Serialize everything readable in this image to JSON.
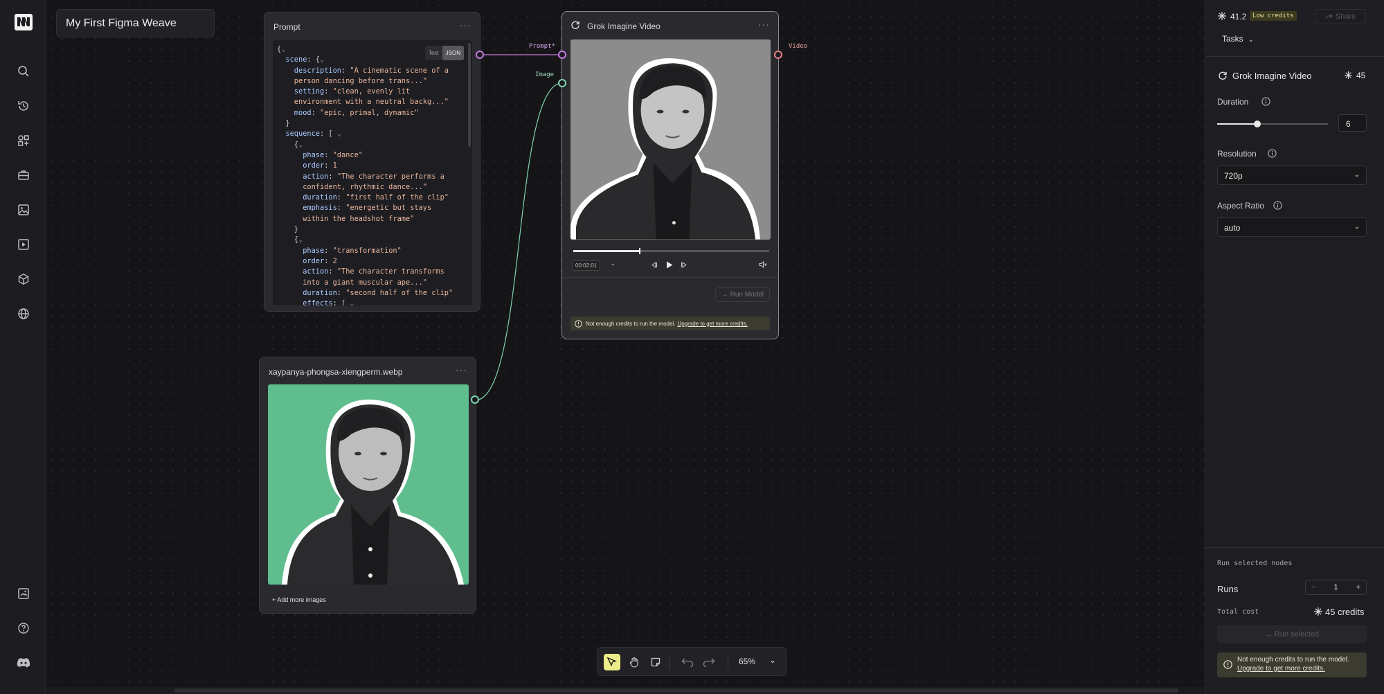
{
  "project": {
    "title": "My First Figma Weave"
  },
  "prompt_node": {
    "title": "Prompt",
    "menu": "···",
    "toggle": [
      "Text",
      "JSON"
    ],
    "lines": [
      [
        {
          "t": "{",
          "c": "p"
        },
        {
          "t": "⌄",
          "c": "c"
        }
      ],
      [
        {
          "t": "  scene",
          "c": "k"
        },
        {
          "t": ": {",
          "c": "p"
        },
        {
          "t": "⌄",
          "c": "c"
        }
      ],
      [
        {
          "t": "    description",
          "c": "k"
        },
        {
          "t": ": ",
          "c": "p"
        },
        {
          "t": "\"A cinematic scene of a",
          "c": "s"
        }
      ],
      [
        {
          "t": "    person dancing before trans...\"",
          "c": "s"
        }
      ],
      [
        {
          "t": "    setting",
          "c": "k"
        },
        {
          "t": ": ",
          "c": "p"
        },
        {
          "t": "\"clean, evenly lit",
          "c": "s"
        }
      ],
      [
        {
          "t": "    environment with a neutral backg...\"",
          "c": "s"
        }
      ],
      [
        {
          "t": "    mood",
          "c": "k"
        },
        {
          "t": ": ",
          "c": "p"
        },
        {
          "t": "\"epic, primal, dynamic\"",
          "c": "s"
        }
      ],
      [
        {
          "t": "  }",
          "c": "p"
        }
      ],
      [
        {
          "t": "  sequence",
          "c": "k"
        },
        {
          "t": ": [ ",
          "c": "p"
        },
        {
          "t": "⌄",
          "c": "c"
        }
      ],
      [
        {
          "t": "    {",
          "c": "p"
        },
        {
          "t": "⌄",
          "c": "c"
        }
      ],
      [
        {
          "t": "      phase",
          "c": "k"
        },
        {
          "t": ": ",
          "c": "p"
        },
        {
          "t": "\"dance\"",
          "c": "s"
        }
      ],
      [
        {
          "t": "      order",
          "c": "k"
        },
        {
          "t": ": ",
          "c": "p"
        },
        {
          "t": "1",
          "c": "n"
        }
      ],
      [
        {
          "t": "      action",
          "c": "k"
        },
        {
          "t": ": ",
          "c": "p"
        },
        {
          "t": "\"The character performs a",
          "c": "s"
        }
      ],
      [
        {
          "t": "      confident, rhythmic dance...\"",
          "c": "s"
        }
      ],
      [
        {
          "t": "      duration",
          "c": "k"
        },
        {
          "t": ": ",
          "c": "p"
        },
        {
          "t": "\"first half of the clip\"",
          "c": "s"
        }
      ],
      [
        {
          "t": "      emphasis",
          "c": "k"
        },
        {
          "t": ": ",
          "c": "p"
        },
        {
          "t": "\"energetic but stays",
          "c": "s"
        }
      ],
      [
        {
          "t": "      within the headshot frame\"",
          "c": "s"
        }
      ],
      [
        {
          "t": "    }",
          "c": "p"
        }
      ],
      [
        {
          "t": "    {",
          "c": "p"
        },
        {
          "t": "⌄",
          "c": "c"
        }
      ],
      [
        {
          "t": "      phase",
          "c": "k"
        },
        {
          "t": ": ",
          "c": "p"
        },
        {
          "t": "\"transformation\"",
          "c": "s"
        }
      ],
      [
        {
          "t": "      order",
          "c": "k"
        },
        {
          "t": ": ",
          "c": "p"
        },
        {
          "t": "2",
          "c": "n"
        }
      ],
      [
        {
          "t": "      action",
          "c": "k"
        },
        {
          "t": ": ",
          "c": "p"
        },
        {
          "t": "\"The character transforms",
          "c": "s"
        }
      ],
      [
        {
          "t": "      into a giant muscular ape...\"",
          "c": "s"
        }
      ],
      [
        {
          "t": "      duration",
          "c": "k"
        },
        {
          "t": ": ",
          "c": "p"
        },
        {
          "t": "\"second half of the clip\"",
          "c": "s"
        }
      ],
      [
        {
          "t": "      effects",
          "c": "k"
        },
        {
          "t": ": [ ",
          "c": "p"
        },
        {
          "t": "⌄",
          "c": "c"
        }
      ]
    ]
  },
  "image_node": {
    "title": "xaypanya-phongsa-xiengperm.webp",
    "menu": "···",
    "add_more": "+ Add more images"
  },
  "video_node": {
    "title": "Grok Imagine Video",
    "menu": "···",
    "progress": 0.34,
    "time": "00:02:01",
    "run_model": "→ Run Model",
    "warning": "Not enough credits to run the model.",
    "warning_link": "Upgrade to get more credits."
  },
  "ports": {
    "prompt_in": "Prompt*",
    "image_in": "Image",
    "video_out": "Video"
  },
  "colors": {
    "prompt_port": "#c77adf",
    "image_port": "#7fd4b0",
    "video_port": "#e37f7f",
    "accent_yellow": "#ecec8a",
    "image_bg": "#5fbd8e"
  },
  "panel": {
    "credits": "41.2",
    "low_credits": "Low credits",
    "share": "Share",
    "tasks": "Tasks",
    "model_name": "Grok Imagine Video",
    "model_cost": "45",
    "duration_label": "Duration",
    "duration_value": "6",
    "duration_fraction": 0.36,
    "resolution_label": "Resolution",
    "resolution_value": "720p",
    "aspect_label": "Aspect Ratio",
    "aspect_value": "auto",
    "run_selected_nodes": "Run selected nodes",
    "runs_label": "Runs",
    "runs_value": "1",
    "minus": "−",
    "plus": "+",
    "total_cost_label": "Total cost",
    "total_cost_value": "45 credits",
    "run_selected": "→ Run selected",
    "warning": "Not enough credits to run the model.",
    "warning_link": "Upgrade to get more credits."
  },
  "toolbar": {
    "zoom": "65%"
  },
  "rail_icons": [
    "search-icon",
    "history-icon",
    "apps-icon",
    "briefcase-icon",
    "image-icon",
    "video-icon",
    "cube-icon",
    "globe-icon",
    "gallery-icon",
    "help-icon",
    "discord-icon"
  ]
}
